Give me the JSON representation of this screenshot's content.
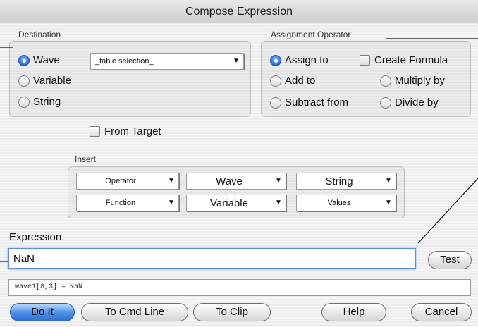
{
  "window": {
    "title": "Compose Expression"
  },
  "destination": {
    "label": "Destination",
    "options": [
      "Wave",
      "Variable",
      "String"
    ],
    "selected": "Wave",
    "wave_popup": "_table selection_"
  },
  "assignment": {
    "label": "Assignment Operator",
    "options": [
      "Assign to",
      "Add to",
      "Multiply by",
      "Subtract from",
      "Divide by"
    ],
    "selected": "Assign to",
    "create_formula_label": "Create Formula",
    "create_formula_checked": false
  },
  "from_target": {
    "label": "From Target",
    "checked": false
  },
  "insert": {
    "label": "Insert",
    "popups": [
      "Operator",
      "Wave",
      "String",
      "Function",
      "Variable",
      "Values"
    ]
  },
  "expression": {
    "label": "Expression:",
    "value": "NaN"
  },
  "result_line": "wave1[8,3] = NaN",
  "buttons": {
    "test": "Test",
    "do_it": "Do It",
    "to_cmd_line": "To Cmd Line",
    "to_clip": "To Clip",
    "help": "Help",
    "cancel": "Cancel"
  },
  "colors": {
    "accent": "#2f6fd0",
    "focus_ring": "#5a8fe0"
  }
}
